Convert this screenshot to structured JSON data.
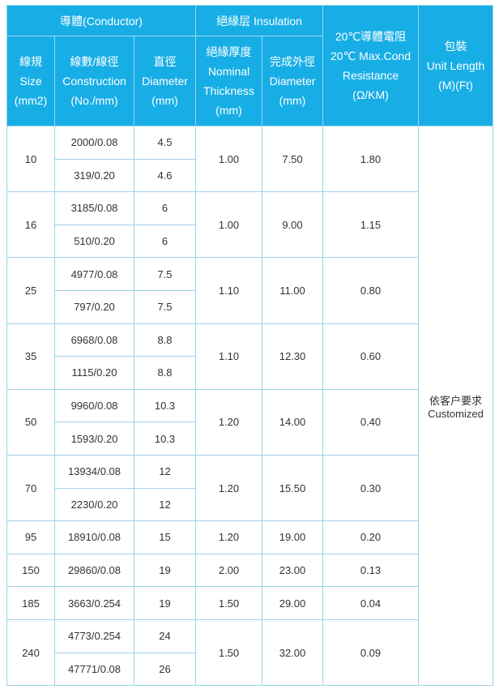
{
  "header": {
    "conductor_group": "導體(Conductor)",
    "insulation_group": "絕緣层 Insulation",
    "resistance": [
      "20℃導體電阻",
      "20℃ Max.Cond",
      "Resistance",
      "(Ω/KM)"
    ],
    "package": [
      "包裝",
      "Unit Length",
      "(M)(Ft)"
    ],
    "size": [
      "線規",
      "Size",
      "(mm2)"
    ],
    "construction": [
      "線數/線徑",
      "Construction",
      "(No./mm)"
    ],
    "conductor_diameter": [
      "直徑",
      "Diameter",
      "(mm)"
    ],
    "thickness": [
      "絕緣厚度",
      "Nominal",
      "Thickness",
      "(mm)"
    ],
    "outer_diameter": [
      "完成外徑",
      "Diameter",
      "(mm)"
    ]
  },
  "package_note": [
    "依客户要求",
    "Customized"
  ],
  "groups": [
    {
      "size": "10",
      "thickness": "1.00",
      "outer_diameter": "7.50",
      "resistance": "1.80",
      "rows": [
        {
          "construction": "2000/0.08",
          "diameter": "4.5"
        },
        {
          "construction": "319/0.20",
          "diameter": "4.6"
        }
      ]
    },
    {
      "size": "16",
      "thickness": "1.00",
      "outer_diameter": "9.00",
      "resistance": "1.15",
      "rows": [
        {
          "construction": "3185/0.08",
          "diameter": "6"
        },
        {
          "construction": "510/0.20",
          "diameter": "6"
        }
      ]
    },
    {
      "size": "25",
      "thickness": "1.10",
      "outer_diameter": "11.00",
      "resistance": "0.80",
      "rows": [
        {
          "construction": "4977/0.08",
          "diameter": "7.5"
        },
        {
          "construction": "797/0.20",
          "diameter": "7.5"
        }
      ]
    },
    {
      "size": "35",
      "thickness": "1.10",
      "outer_diameter": "12.30",
      "resistance": "0.60",
      "rows": [
        {
          "construction": "6968/0.08",
          "diameter": "8.8"
        },
        {
          "construction": "1115/0.20",
          "diameter": "8.8"
        }
      ]
    },
    {
      "size": "50",
      "thickness": "1.20",
      "outer_diameter": "14.00",
      "resistance": "0.40",
      "rows": [
        {
          "construction": "9960/0.08",
          "diameter": "10.3"
        },
        {
          "construction": "1593/0.20",
          "diameter": "10.3"
        }
      ]
    },
    {
      "size": "70",
      "thickness": "1.20",
      "outer_diameter": "15.50",
      "resistance": "0.30",
      "rows": [
        {
          "construction": "13934/0.08",
          "diameter": "12"
        },
        {
          "construction": "2230/0.20",
          "diameter": "12"
        }
      ]
    },
    {
      "size": "95",
      "thickness": "1.20",
      "outer_diameter": "19.00",
      "resistance": "0.20",
      "rows": [
        {
          "construction": "18910/0.08",
          "diameter": "15"
        }
      ]
    },
    {
      "size": "150",
      "thickness": "2.00",
      "outer_diameter": "23.00",
      "resistance": "0.13",
      "rows": [
        {
          "construction": "29860/0.08",
          "diameter": "19"
        }
      ]
    },
    {
      "size": "185",
      "thickness": "1.50",
      "outer_diameter": "29.00",
      "resistance": "0.04",
      "rows": [
        {
          "construction": "3663/0.254",
          "diameter": "19"
        }
      ]
    },
    {
      "size": "240",
      "thickness": "1.50",
      "outer_diameter": "32.00",
      "resistance": "0.09",
      "rows": [
        {
          "construction": "4773/0.254",
          "diameter": "24"
        },
        {
          "construction": "47771/0.08",
          "diameter": "26"
        }
      ]
    }
  ],
  "style": {
    "header_bg": "#17aee6",
    "border": "#9fd3ea",
    "text": "#333333"
  }
}
